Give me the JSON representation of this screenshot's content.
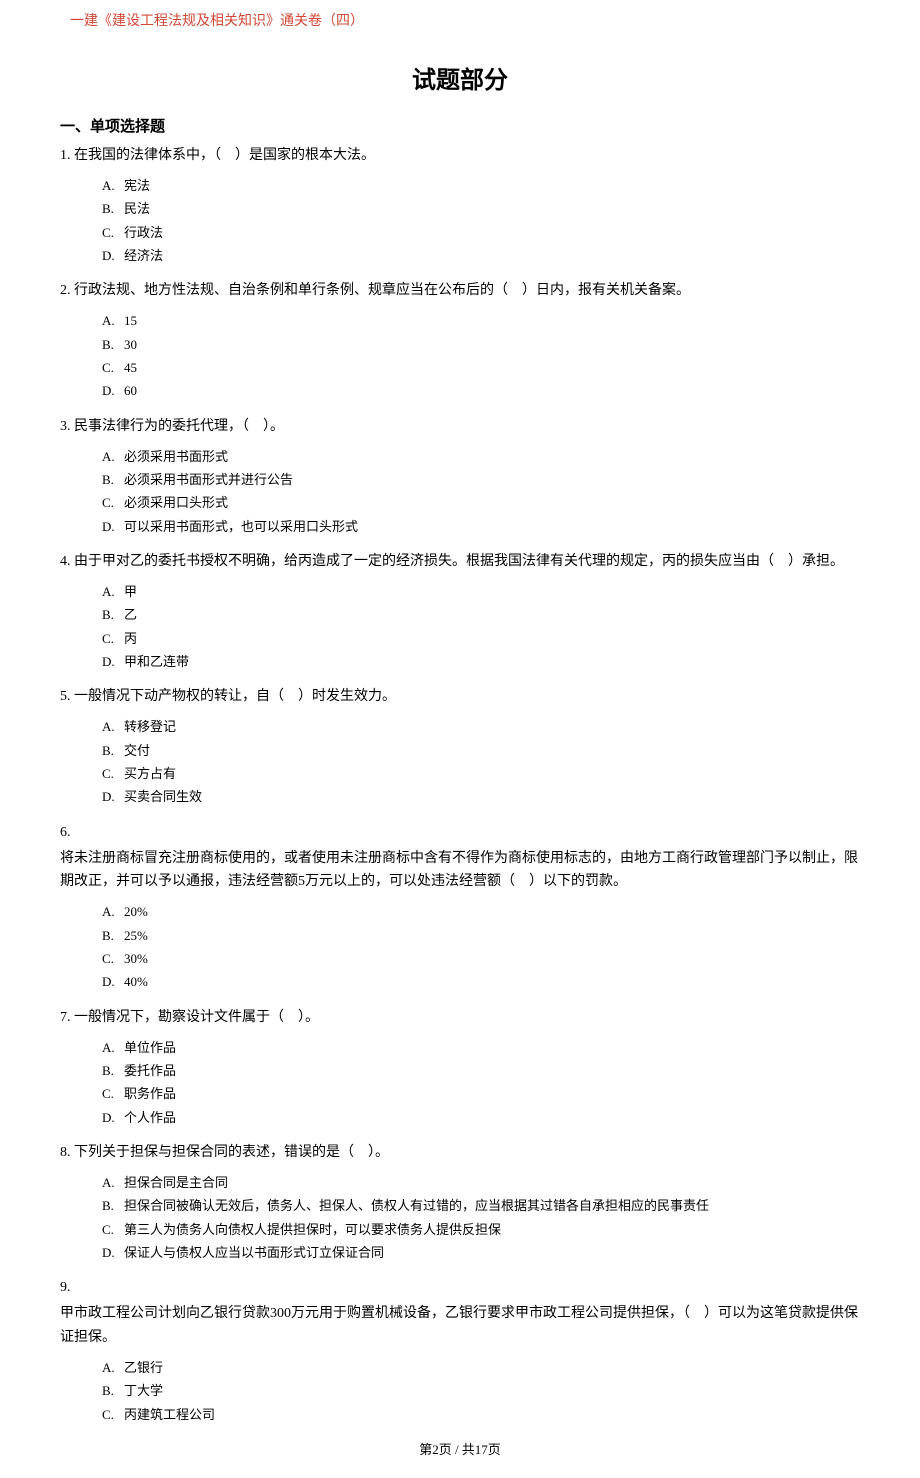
{
  "header": "一建《建设工程法规及相关知识》通关卷（四）",
  "mainTitle": "试题部分",
  "sectionHeading": "一、单项选择题",
  "questions": [
    {
      "num": "1.",
      "text": "在我国的法律体系中，（　）是国家的根本大法。",
      "options": [
        {
          "label": "A.",
          "text": "宪法"
        },
        {
          "label": "B.",
          "text": "民法"
        },
        {
          "label": "C.",
          "text": "行政法"
        },
        {
          "label": "D.",
          "text": "经济法"
        }
      ]
    },
    {
      "num": "2.",
      "text": "行政法规、地方性法规、自治条例和单行条例、规章应当在公布后的（　）日内，报有关机关备案。",
      "options": [
        {
          "label": "A.",
          "text": "15"
        },
        {
          "label": "B.",
          "text": "30"
        },
        {
          "label": "C.",
          "text": "45"
        },
        {
          "label": "D.",
          "text": "60"
        }
      ]
    },
    {
      "num": "3.",
      "text": "民事法律行为的委托代理，（　）。",
      "options": [
        {
          "label": "A.",
          "text": "必须采用书面形式"
        },
        {
          "label": "B.",
          "text": "必须采用书面形式并进行公告"
        },
        {
          "label": "C.",
          "text": "必须采用口头形式"
        },
        {
          "label": "D.",
          "text": "可以采用书面形式，也可以采用口头形式"
        }
      ]
    },
    {
      "num": "4.",
      "text": "由于甲对乙的委托书授权不明确，给丙造成了一定的经济损失。根据我国法律有关代理的规定，丙的损失应当由（　）承担。",
      "options": [
        {
          "label": "A.",
          "text": "甲"
        },
        {
          "label": "B.",
          "text": "乙"
        },
        {
          "label": "C.",
          "text": "丙"
        },
        {
          "label": "D.",
          "text": "甲和乙连带"
        }
      ]
    },
    {
      "num": "5.",
      "text": "一般情况下动产物权的转让，自（　）时发生效力。",
      "options": [
        {
          "label": "A.",
          "text": "转移登记"
        },
        {
          "label": "B.",
          "text": "交付"
        },
        {
          "label": "C.",
          "text": "买方占有"
        },
        {
          "label": "D.",
          "text": "买卖合同生效"
        }
      ]
    },
    {
      "num": "6.",
      "wrapped": true,
      "text": "将未注册商标冒充注册商标使用的，或者使用未注册商标中含有不得作为商标使用标志的，由地方工商行政管理部门予以制止，限期改正，并可以予以通报，违法经营额5万元以上的，可以处违法经营额（　）以下的罚款。",
      "options": [
        {
          "label": "A.",
          "text": "20%"
        },
        {
          "label": "B.",
          "text": "25%"
        },
        {
          "label": "C.",
          "text": "30%"
        },
        {
          "label": "D.",
          "text": "40%"
        }
      ]
    },
    {
      "num": "7.",
      "text": "一般情况下，勘察设计文件属于（　）。",
      "options": [
        {
          "label": "A.",
          "text": "单位作品"
        },
        {
          "label": "B.",
          "text": "委托作品"
        },
        {
          "label": "C.",
          "text": "职务作品"
        },
        {
          "label": "D.",
          "text": "个人作品"
        }
      ]
    },
    {
      "num": "8.",
      "text": "下列关于担保与担保合同的表述，错误的是（　）。",
      "options": [
        {
          "label": "A.",
          "text": "担保合同是主合同"
        },
        {
          "label": "B.",
          "text": "担保合同被确认无效后，债务人、担保人、债权人有过错的，应当根据其过错各自承担相应的民事责任"
        },
        {
          "label": "C.",
          "text": "第三人为债务人向债权人提供担保时，可以要求债务人提供反担保"
        },
        {
          "label": "D.",
          "text": "保证人与债权人应当以书面形式订立保证合同"
        }
      ]
    },
    {
      "num": "9.",
      "wrapped": true,
      "text": "甲市政工程公司计划向乙银行贷款300万元用于购置机械设备，乙银行要求甲市政工程公司提供担保，（　）可以为这笔贷款提供保证担保。",
      "options": [
        {
          "label": "A.",
          "text": "乙银行"
        },
        {
          "label": "B.",
          "text": "丁大学"
        },
        {
          "label": "C.",
          "text": "丙建筑工程公司"
        }
      ]
    }
  ],
  "footer": "第2页  /  共17页"
}
